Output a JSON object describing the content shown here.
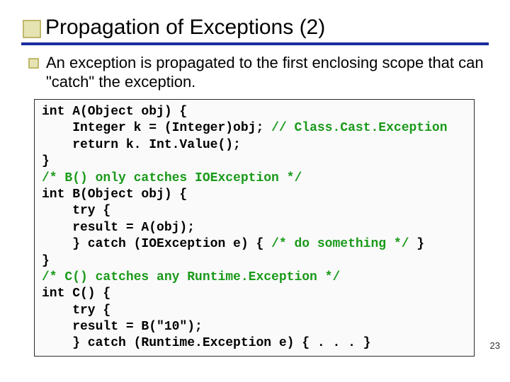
{
  "title": "Propagation of Exceptions (2)",
  "bullet": "An exception is propagated to the first enclosing scope that can \"catch\" the exception.",
  "code": {
    "l1a": "int A(Object obj) {",
    "l2a": "    Integer k = (Integer)obj; ",
    "l2b": "// Class.Cast.Exception",
    "l3a": "    return k. Int.Value();",
    "l4a": "}",
    "l5a": "/* B() only catches IOException */",
    "l6a": "int B(Object obj) {",
    "l7a": "    try {",
    "l8a": "    result = A(obj);",
    "l9a": "    } catch (IOException e) { ",
    "l9b": "/* do something */",
    "l9c": " }",
    "l10a": "}",
    "l11a": "/* C() catches any Runtime.Exception */",
    "l12a": "int C() {",
    "l13a": "    try {",
    "l14a": "    result = B(\"10\");",
    "l15a": "    } catch (Runtime.Exception e) { . . . }"
  },
  "pageNumber": "23"
}
